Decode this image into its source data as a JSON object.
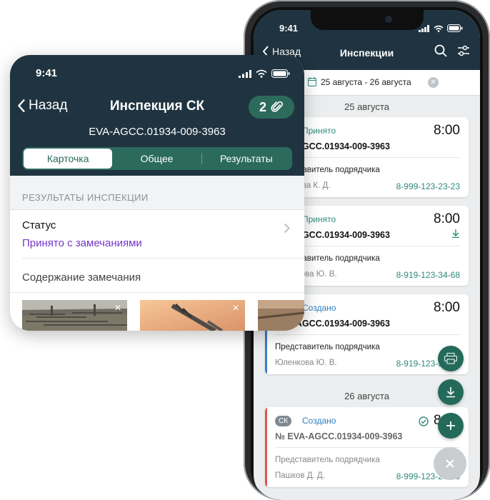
{
  "back_phone": {
    "status_time": "9:41",
    "nav": {
      "back_label": "Назад",
      "title": "Инспекции"
    },
    "date_range": "25 августа - 26 августа",
    "days": [
      {
        "label": "25 августа",
        "cards": [
          {
            "status": "Принято",
            "time": "8:00",
            "number": "EVA-AGCC.01934-009-3963",
            "rep_label": "Представитель подрядчика",
            "name": "Ефимова К. Д.",
            "phone": "8-999-123-23-23"
          },
          {
            "status": "Принято",
            "time": "8:00",
            "number": "EVA-AGCC.01934-009-3963",
            "rep_label": "Представитель подрядчика",
            "name": "Юленкова Ю. В.",
            "phone": "8-919-123-34-68"
          },
          {
            "status": "Создано",
            "time": "8:00",
            "number": "EVA-AGCC.01934-009-3963",
            "rep_label": "Представитель подрядчика",
            "name": "Юленкова Ю. В.",
            "phone": "8-919-123-34-68"
          }
        ]
      },
      {
        "label": "26 августа",
        "cards": [
          {
            "badge": "СК",
            "status": "Создано",
            "time": "8:00",
            "number": "№ EVA-AGCC.01934-009-3963",
            "rep_label": "Представитель подрядчика",
            "name": "Пашков Д. Д.",
            "phone": "8-999-123-23-23"
          }
        ]
      }
    ],
    "colors": {
      "header": "#1f3440",
      "accent_green": "#2e8b78",
      "status_blue": "#2d7fc1",
      "bar_blue": "#3a7cc4",
      "bar_red": "#e05454"
    }
  },
  "front_card": {
    "status_time": "9:41",
    "nav": {
      "back_label": "Назад",
      "title": "Инспекция СК",
      "attachments_count": "2"
    },
    "subtitle": "EVA-AGCC.01934-009-3963",
    "tabs": [
      {
        "label": "Карточка",
        "active": true
      },
      {
        "label": "Общее",
        "active": false
      },
      {
        "label": "Результаты",
        "active": false
      }
    ],
    "section_title": "РЕЗУЛЬТАТЫ ИНСПЕКЦИИ",
    "status_label": "Статус",
    "status_value": "Принято с замечаниями",
    "remark_label": "Содержание замечания",
    "colors": {
      "header": "#1f3440",
      "segment": "#2b6a5d",
      "status_value": "#7436c9"
    }
  }
}
